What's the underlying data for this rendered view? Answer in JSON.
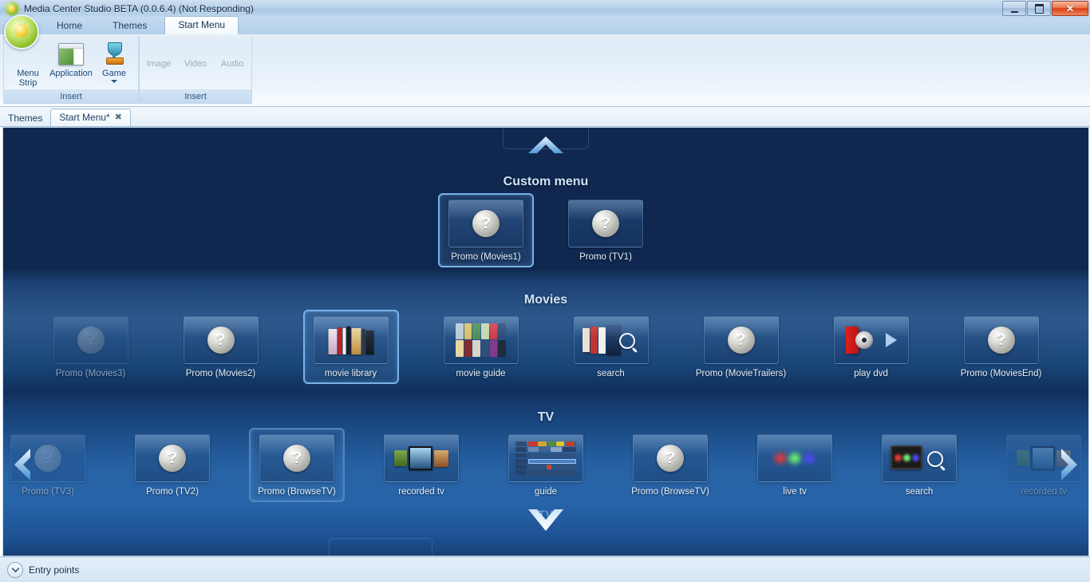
{
  "window": {
    "title": "Media Center Studio BETA (0.0.6.4) (Not Responding)",
    "app_icon": "media-center-studio-orb-icon",
    "controls": {
      "minimize": "–",
      "restore": "❐",
      "close": "✕"
    }
  },
  "ribbon": {
    "tabs": [
      {
        "label": "Home",
        "active": false
      },
      {
        "label": "Themes",
        "active": false
      },
      {
        "label": "Start Menu",
        "active": true
      }
    ],
    "groups": [
      {
        "label": "Insert",
        "items": [
          {
            "label": "Menu Strip",
            "icon": "menu-strip-icon",
            "disabled": false,
            "has_dropdown": false
          },
          {
            "label": "Application",
            "icon": "application-window-icon",
            "disabled": false,
            "has_dropdown": false
          },
          {
            "label": "Game",
            "icon": "trophy-icon",
            "disabled": false,
            "has_dropdown": true
          }
        ]
      },
      {
        "label": "Insert",
        "items": [
          {
            "label": "Image",
            "icon": "image-icon",
            "disabled": true,
            "has_dropdown": false
          },
          {
            "label": "Video",
            "icon": "video-icon",
            "disabled": true,
            "has_dropdown": false
          },
          {
            "label": "Audio",
            "icon": "audio-icon",
            "disabled": true,
            "has_dropdown": false
          }
        ]
      }
    ]
  },
  "document_tabs": [
    {
      "label": "Themes",
      "active": false,
      "closable": false
    },
    {
      "label": "Start Menu*",
      "active": true,
      "closable": true,
      "close_glyph": "✖"
    }
  ],
  "canvas": {
    "nav": {
      "up_chevron": "chevron-up-icon",
      "down_chevron": "chevron-down-icon",
      "down_label": "TV",
      "left_arrow": "chevron-left-icon",
      "right_arrow": "chevron-right-icon"
    },
    "sections": [
      {
        "title": "Custom menu",
        "name": "custom-menu",
        "tiles": [
          {
            "label": "Promo (Movies1)",
            "art": "question",
            "selected": true,
            "fade": "none"
          },
          {
            "label": "Promo (TV1)",
            "art": "question",
            "selected": false,
            "fade": "none"
          }
        ]
      },
      {
        "title": "Movies",
        "name": "movies",
        "tiles": [
          {
            "label": "Promo (Movies3)",
            "art": "question",
            "selected": false,
            "fade": "faded"
          },
          {
            "label": "Promo (Movies2)",
            "art": "question",
            "selected": false,
            "fade": "none"
          },
          {
            "label": "movie library",
            "art": "bookshelf",
            "selected": true,
            "fade": "none"
          },
          {
            "label": "movie guide",
            "art": "poster-grid",
            "selected": false,
            "fade": "none"
          },
          {
            "label": "search",
            "art": "posters-search",
            "selected": false,
            "fade": "none"
          },
          {
            "label": "Promo (MovieTrailers)",
            "art": "question",
            "selected": false,
            "fade": "none"
          },
          {
            "label": "play dvd",
            "art": "dvd",
            "selected": false,
            "fade": "none"
          },
          {
            "label": "Promo (MoviesEnd)",
            "art": "question",
            "selected": false,
            "fade": "none"
          }
        ]
      },
      {
        "title": "TV",
        "name": "tv",
        "tiles": [
          {
            "label": "Promo (TV3)",
            "art": "question",
            "selected": false,
            "fade": "faded"
          },
          {
            "label": "Promo (TV2)",
            "art": "question",
            "selected": false,
            "fade": "none"
          },
          {
            "label": "Promo (BrowseTV)",
            "art": "question",
            "selected": true,
            "fade": "none"
          },
          {
            "label": "recorded tv",
            "art": "rec-thumbs",
            "selected": false,
            "fade": "none"
          },
          {
            "label": "guide",
            "art": "epg",
            "selected": false,
            "fade": "none"
          },
          {
            "label": "Promo (BrowseTV)",
            "art": "question",
            "selected": false,
            "fade": "none"
          },
          {
            "label": "live tv",
            "art": "rgb-blobs",
            "selected": false,
            "fade": "none"
          },
          {
            "label": "search",
            "art": "tv-search",
            "selected": false,
            "fade": "none"
          },
          {
            "label": "recorded tv",
            "art": "rec-thumbs",
            "selected": false,
            "fade": "faded2"
          }
        ]
      }
    ]
  },
  "statusbar": {
    "toggle_icon": "chevron-down-circle-icon",
    "text": "Entry points"
  },
  "colors": {
    "accent_selection": "#79b3e8",
    "canvas_dark": "#10284f",
    "canvas_light": "#1d5aa0",
    "close_button": "#d7401a",
    "ribbon_blue": "#b2cfe9"
  }
}
